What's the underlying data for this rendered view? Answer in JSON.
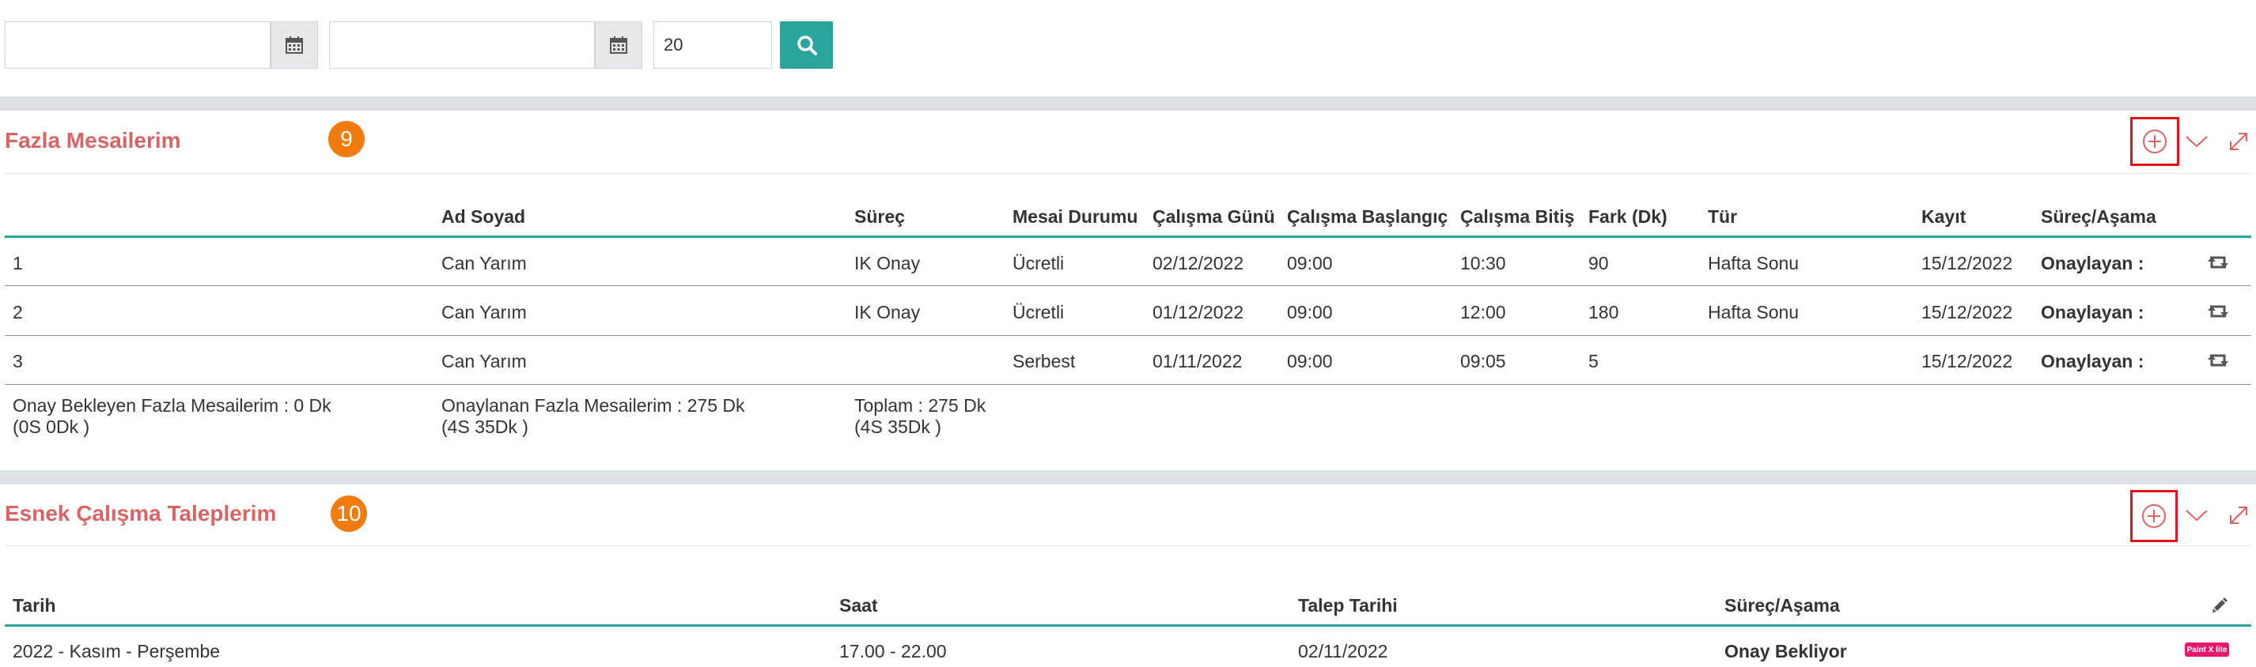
{
  "filter": {
    "start_date": "",
    "end_date": "",
    "page_size": "20"
  },
  "overtime": {
    "title": "Fazla Mesailerim",
    "badge": "9",
    "columns": [
      "",
      "Ad Soyad",
      "Süreç",
      "Mesai Durumu",
      "Çalışma Günü",
      "Çalışma Başlangıç",
      "Çalışma Bitiş",
      "Fark (Dk)",
      "Tür",
      "Kayıt",
      "Süreç/Aşama"
    ],
    "rows": [
      {
        "no": "1",
        "name": "Can Yarım",
        "process": "IK Onay",
        "status": "Ücretli",
        "day": "02/12/2022",
        "start": "09:00",
        "end": "10:30",
        "diff": "90",
        "type": "Hafta Sonu",
        "record": "15/12/2022",
        "stage": "Onaylayan :"
      },
      {
        "no": "2",
        "name": "Can Yarım",
        "process": "IK Onay",
        "status": "Ücretli",
        "day": "01/12/2022",
        "start": "09:00",
        "end": "12:00",
        "diff": "180",
        "type": "Hafta Sonu",
        "record": "15/12/2022",
        "stage": "Onaylayan :"
      },
      {
        "no": "3",
        "name": "Can Yarım",
        "process": "",
        "status": "Serbest",
        "day": "01/11/2022",
        "start": "09:00",
        "end": "09:05",
        "diff": "5",
        "type": "",
        "record": "15/12/2022",
        "stage": "Onaylayan :"
      }
    ],
    "summary": {
      "pending_line1": "Onay Bekleyen Fazla Mesailerim : 0 Dk",
      "pending_line2": "(0S 0Dk )",
      "approved_line1": "Onaylanan Fazla Mesailerim : 275 Dk",
      "approved_line2": "(4S 35Dk )",
      "total_line1": "Toplam : 275 Dk",
      "total_line2": "(4S 35Dk )"
    }
  },
  "flex": {
    "title": "Esnek Çalışma Taleplerim",
    "badge": "10",
    "columns": [
      "Tarih",
      "Saat",
      "Talep Tarihi",
      "Süreç/Aşama"
    ],
    "rows": [
      {
        "date": "2022 - Kasım - Perşembe",
        "hour": "17.00 - 22.00",
        "request_date": "02/11/2022",
        "stage": "Onay Bekliyor"
      }
    ],
    "watermark": "Paint X lite"
  },
  "icons": {
    "calendar": "calendar-icon",
    "search": "search-icon",
    "add": "add-circle-icon",
    "collapse": "chevron-down-icon",
    "expand": "expand-icon",
    "refresh": "retweet-icon",
    "edit": "pencil-icon"
  },
  "colors": {
    "accent": "#2ba59a",
    "title": "#d96466",
    "badge": "#f07b0e",
    "highlight": "#e1141a"
  }
}
